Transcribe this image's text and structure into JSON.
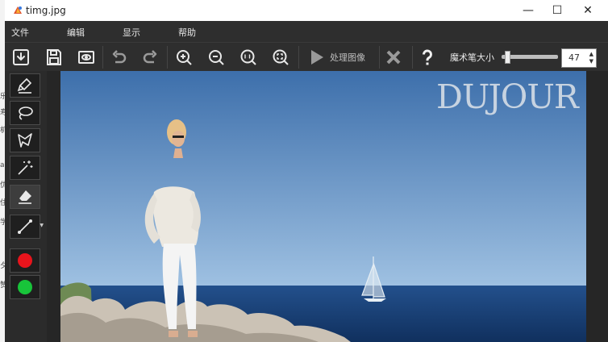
{
  "window": {
    "title": "timg.jpg",
    "controls": {
      "minimize": "—",
      "maximize": "☐",
      "close": "✕"
    }
  },
  "menu": [
    "文件",
    "编辑",
    "显示",
    "帮助"
  ],
  "toolbar": {
    "process_label": "处理图像",
    "brush_size_label": "魔术笔大小",
    "brush_size_value": "47",
    "brush_size_fraction": 0.05
  },
  "sidebar": {
    "tools": [
      "marker-tool",
      "lasso-tool",
      "polygon-lasso-tool",
      "magic-wand-tool",
      "eraser-tool",
      "line-tool",
      "red-color",
      "green-color"
    ],
    "colors": {
      "red": "#e8141c",
      "green": "#18c43a"
    }
  },
  "image": {
    "watermark": "DUJOUR"
  },
  "edge_texts": [
    "乐",
    "寿",
    "机",
    "ai",
    "优",
    "住",
    "学",
    "夕",
    "赞"
  ]
}
